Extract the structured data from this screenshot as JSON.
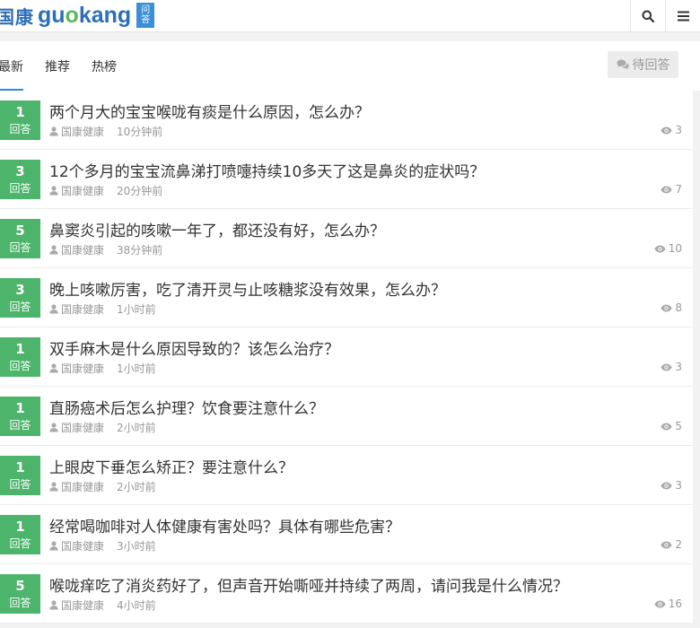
{
  "header": {
    "logo_cn": "国康",
    "logo_en_prefix": "gu",
    "logo_en_o": "o",
    "logo_en_suffix": "kang",
    "logo_badge_top": "问",
    "logo_badge_bottom": "答"
  },
  "tabs": [
    {
      "label": "最新",
      "active": true
    },
    {
      "label": "推荐",
      "active": false
    },
    {
      "label": "热榜",
      "active": false
    }
  ],
  "pending_label": "待回答",
  "answers_label": "回答",
  "colors": {
    "accent": "#4cb46b",
    "brand": "#2d6fb8",
    "tab_underline": "#2d8cd8"
  },
  "questions": [
    {
      "answers": "1",
      "title": "两个月大的宝宝喉咙有痰是什么原因，怎么办？",
      "author": "国康健康",
      "time": "10分钟前",
      "views": "3"
    },
    {
      "answers": "3",
      "title": "12个多月的宝宝流鼻涕打喷嚏持续10多天了这是鼻炎的症状吗？",
      "author": "国康健康",
      "time": "20分钟前",
      "views": "7"
    },
    {
      "answers": "5",
      "title": "鼻窦炎引起的咳嗽一年了，都还没有好，怎么办？",
      "author": "国康健康",
      "time": "38分钟前",
      "views": "10"
    },
    {
      "answers": "3",
      "title": "晚上咳嗽厉害，吃了清开灵与止咳糖浆没有效果，怎么办？",
      "author": "国康健康",
      "time": "1小时前",
      "views": "8"
    },
    {
      "answers": "1",
      "title": "双手麻木是什么原因导致的？该怎么治疗？",
      "author": "国康健康",
      "time": "1小时前",
      "views": "3"
    },
    {
      "answers": "1",
      "title": "直肠癌术后怎么护理？饮食要注意什么？",
      "author": "国康健康",
      "time": "2小时前",
      "views": "5"
    },
    {
      "answers": "1",
      "title": "上眼皮下垂怎么矫正？要注意什么？",
      "author": "国康健康",
      "time": "2小时前",
      "views": "3"
    },
    {
      "answers": "1",
      "title": "经常喝咖啡对人体健康有害处吗？具体有哪些危害？",
      "author": "国康健康",
      "time": "3小时前",
      "views": "2"
    },
    {
      "answers": "5",
      "title": "喉咙痒吃了消炎药好了，但声音开始嘶哑并持续了两周，请问我是什么情况？",
      "author": "国康健康",
      "time": "4小时前",
      "views": "16"
    }
  ]
}
